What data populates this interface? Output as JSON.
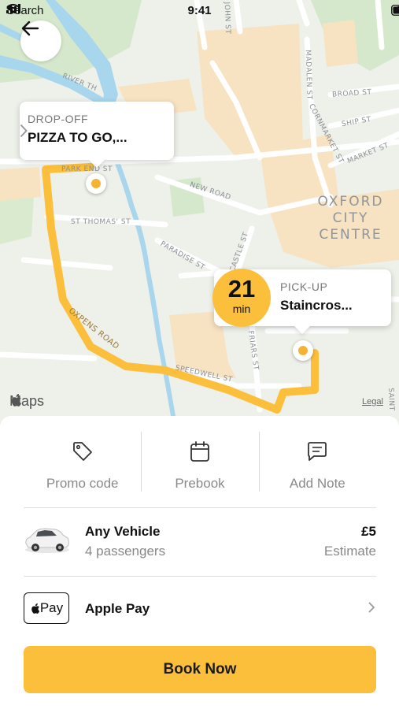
{
  "status_bar": {
    "back_app": "Search",
    "time": "9:41"
  },
  "map": {
    "labels": {
      "river": "RIVER TH",
      "park_end": "PARK END ST",
      "new_road": "NEW ROAD",
      "st_thomas": "ST THOMAS' ST",
      "paradise": "PARADISE ST",
      "castle": "CASTLE ST",
      "oxpens": "OXPENS ROAD",
      "speedwell": "SPEEDWELL ST",
      "friars": "FRIARS ST",
      "john": "JOHN ST",
      "madalen": "MADALEN ST",
      "cornmarket": "CORNMARKET ST",
      "broad": "BROAD ST",
      "ship": "SHIP ST",
      "market": "MARKET ST",
      "saint": "SAINT",
      "area_line1": "OXFORD CITY",
      "area_line2": "CENTRE"
    },
    "dropoff": {
      "caption": "DROP-OFF",
      "name": "PIZZA TO GO,..."
    },
    "pickup": {
      "caption": "PICK-UP",
      "name": "Staincros..."
    },
    "eta": {
      "value": "21",
      "unit": "min"
    },
    "maps_logo": "Maps",
    "legal": "Legal",
    "route_color": "#fbbf3c"
  },
  "actions": [
    {
      "label": "Promo code",
      "icon": "tag-icon"
    },
    {
      "label": "Prebook",
      "icon": "calendar-icon"
    },
    {
      "label": "Add Note",
      "icon": "message-icon"
    }
  ],
  "vehicle": {
    "name": "Any Vehicle",
    "passengers": "4 passengers",
    "price": "£5",
    "price_note": "Estimate"
  },
  "payment": {
    "badge": "Pay",
    "name": "Apple Pay"
  },
  "book_button": "Book Now",
  "colors": {
    "accent": "#fbbf3c",
    "map_bg": "#eef0ea"
  }
}
